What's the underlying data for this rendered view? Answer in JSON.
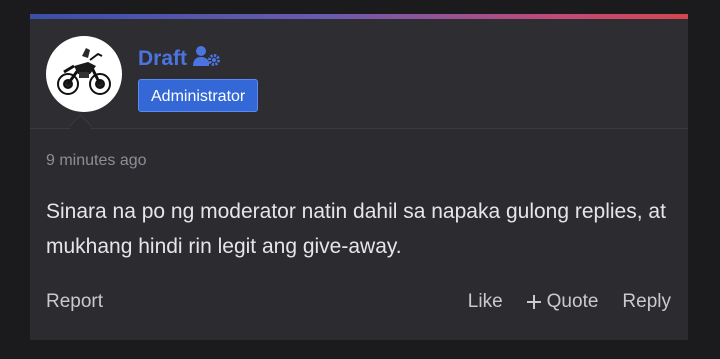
{
  "post": {
    "author": {
      "name": "Draft",
      "role": "Administrator",
      "avatar_icon": "motorcycle-avatar",
      "user_icon": "user-cog-icon"
    },
    "timestamp": "9 minutes ago",
    "body": "Sinara na po ng moderator natin dahil sa napaka gulong replies, at mukhang hindi rin legit ang give-away.",
    "actions": {
      "report": "Report",
      "like": "Like",
      "quote": "Quote",
      "reply": "Reply"
    }
  },
  "colors": {
    "accent_gradient_start": "#3b4fa8",
    "accent_gradient_end": "#d2474f",
    "username": "#4c74e0",
    "badge_bg": "#3468d6",
    "card_bg": "#2b2b30"
  }
}
